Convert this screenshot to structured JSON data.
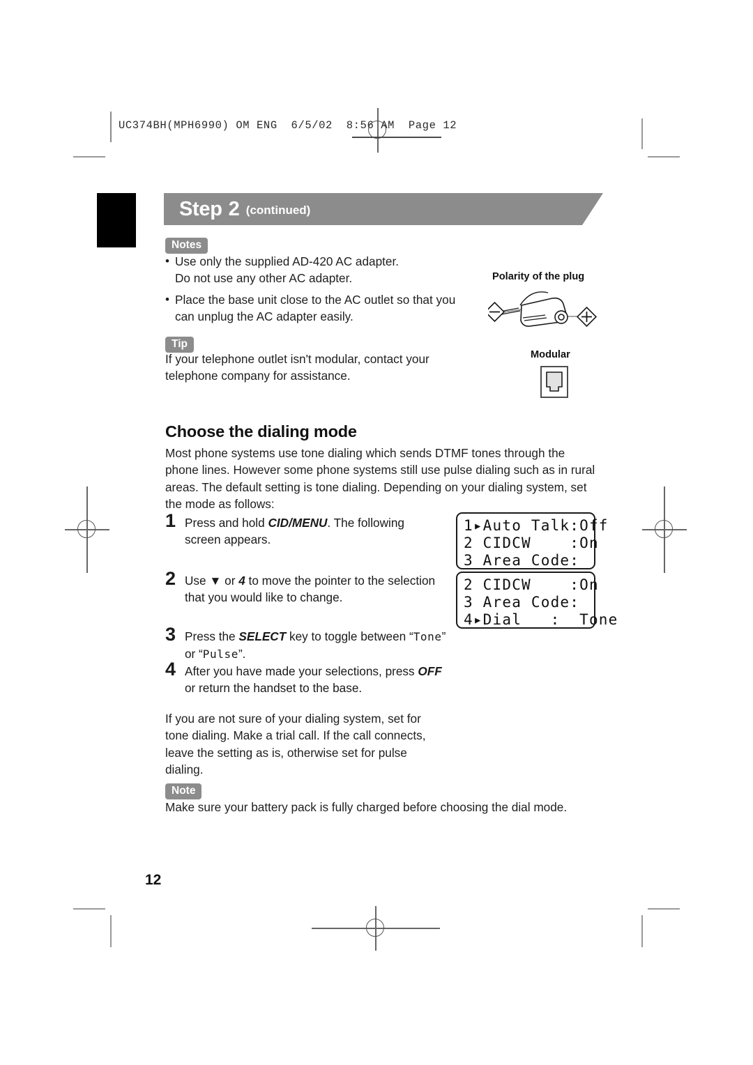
{
  "prepress": {
    "slug": "UC374BH(MPH6990) OM ENG  6/5/02  8:56 AM  Page 12"
  },
  "banner": {
    "step_word": "Step",
    "step_number": "2",
    "continued": "(continued)"
  },
  "notes_block": {
    "chip": "Notes",
    "bullets": [
      "Use only the supplied AD-420 AC adapter.\nDo not use any other AC adapter.",
      "Place the base unit close to the AC outlet so that you can unplug the AC adapter easily."
    ]
  },
  "tip_block": {
    "chip": "Tip",
    "text": "If your telephone outlet isn't modular, contact your telephone company for assistance."
  },
  "figures": {
    "polarity": {
      "label": "Polarity of the plug",
      "minus_symbol": "–",
      "plus_symbol": "+"
    },
    "modular": {
      "label": "Modular"
    }
  },
  "section": {
    "heading": "Choose the dialing mode",
    "intro": "Most phone systems use tone dialing which sends DTMF tones through the phone lines. However some phone systems still use pulse dialing such as in rural areas. The default setting is tone dialing. Depending on your dialing system, set the mode as follows:"
  },
  "steps": [
    {
      "number": "1",
      "text_before": "Press and hold ",
      "emphasis": "CID/MENU",
      "text_after": ". The following screen appears."
    },
    {
      "number": "2",
      "text_before": "Use ",
      "glyph": "▼",
      "text_mid": " or ",
      "emphasis": "4",
      "text_after": " to move the pointer to the selection that you would like to change."
    },
    {
      "number": "3",
      "text_before": "Press the ",
      "emphasis": "SELECT",
      "text_mid": " key to toggle between “",
      "lcd_word_1": "Tone",
      "text_mid2": "” or “",
      "lcd_word_2": "Pulse",
      "text_after": "”."
    },
    {
      "number": "4",
      "text_before": "After you have made your selections, press ",
      "emphasis": "OFF",
      "text_after": " or return the handset to the base."
    }
  ],
  "lcd_screens": [
    {
      "name": "menu-screen-1",
      "lines": [
        "1▸Auto Talk:Off",
        "2 CIDCW    :On",
        "3 Area Code:"
      ]
    },
    {
      "name": "menu-screen-2",
      "lines": [
        "2 CIDCW    :On",
        "3 Area Code:",
        "4▸Dial   :  Tone"
      ]
    }
  ],
  "closing_paragraph": "If you are not sure of your dialing system, set for tone dialing. Make a trial call. If the call connects, leave the setting as is, otherwise set for pulse dialing.",
  "note_block": {
    "chip": "Note",
    "text": "Make sure your battery pack is fully charged before choosing the dial mode."
  },
  "page_number": "12",
  "colors": {
    "chip_gray": "#8c8c8c",
    "banner_gray": "#8c8c8c",
    "tab_black": "#000000",
    "text": "#1f1f1f"
  }
}
